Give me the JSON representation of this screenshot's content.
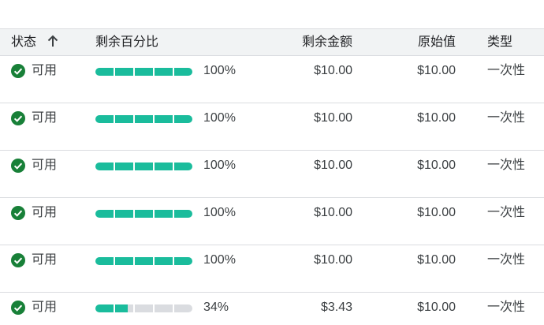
{
  "header": {
    "status": "状态",
    "remaining_pct": "剩余百分比",
    "remaining_amount": "剩余金额",
    "original_value": "原始值",
    "type": "类型"
  },
  "colors": {
    "progress_fill": "#1abc9c",
    "progress_empty": "#dadce0",
    "status_ok": "#188038"
  },
  "rows": [
    {
      "status": "可用",
      "percent": 100,
      "percent_label": "100%",
      "remaining": "$10.00",
      "original": "$10.00",
      "type": "一次性"
    },
    {
      "status": "可用",
      "percent": 100,
      "percent_label": "100%",
      "remaining": "$10.00",
      "original": "$10.00",
      "type": "一次性"
    },
    {
      "status": "可用",
      "percent": 100,
      "percent_label": "100%",
      "remaining": "$10.00",
      "original": "$10.00",
      "type": "一次性"
    },
    {
      "status": "可用",
      "percent": 100,
      "percent_label": "100%",
      "remaining": "$10.00",
      "original": "$10.00",
      "type": "一次性"
    },
    {
      "status": "可用",
      "percent": 100,
      "percent_label": "100%",
      "remaining": "$10.00",
      "original": "$10.00",
      "type": "一次性"
    },
    {
      "status": "可用",
      "percent": 34,
      "percent_label": "34%",
      "remaining": "$3.43",
      "original": "$10.00",
      "type": "一次性"
    }
  ]
}
